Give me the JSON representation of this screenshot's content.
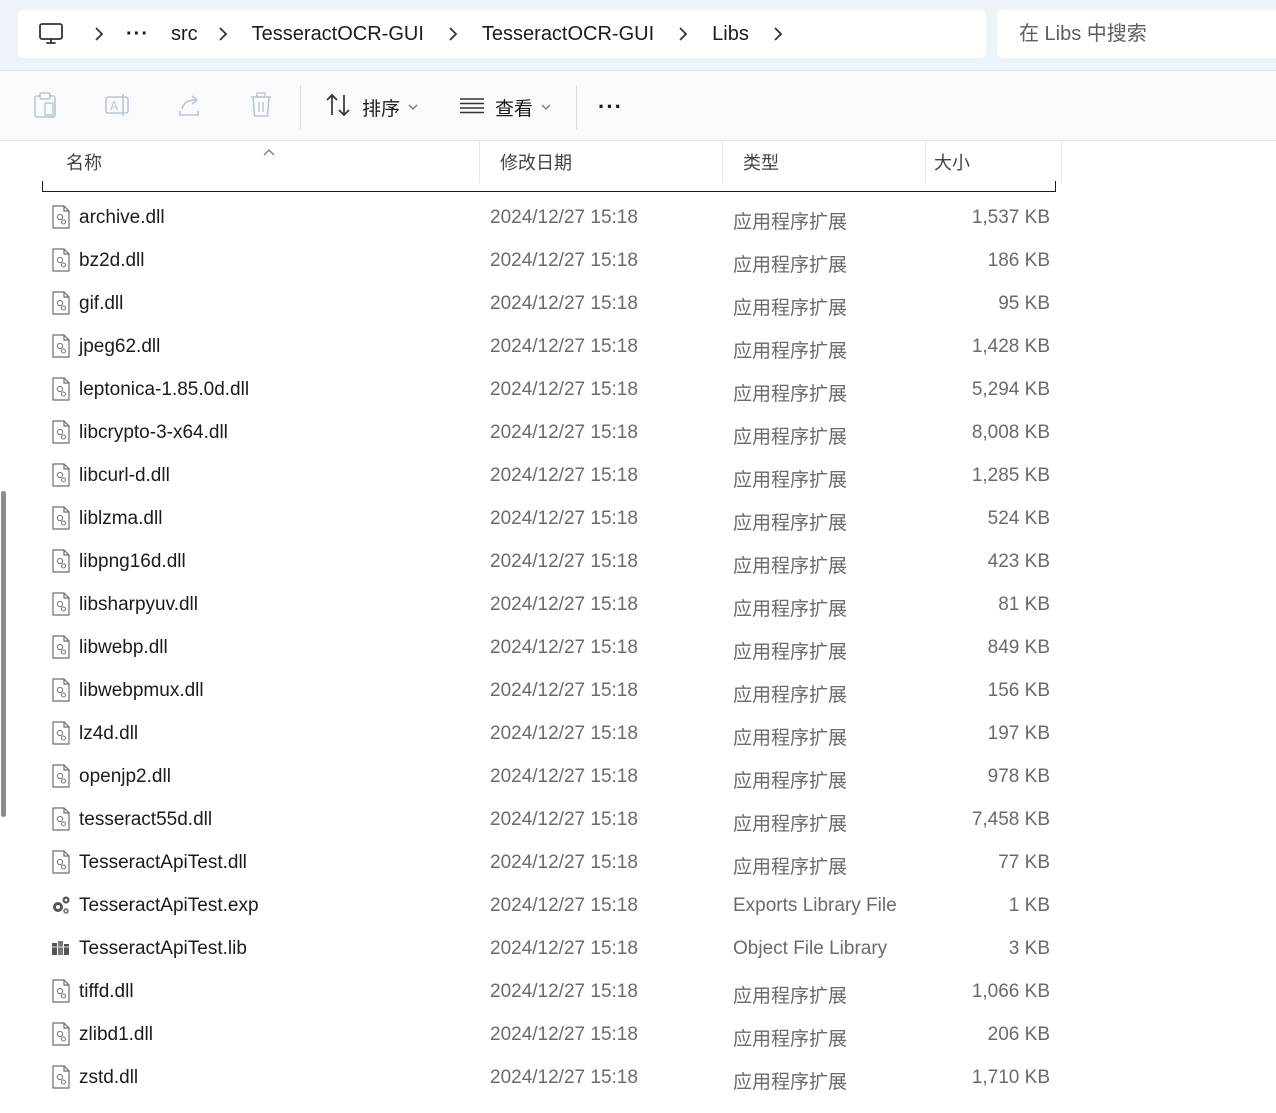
{
  "breadcrumb": {
    "overflow": "···",
    "items": [
      "src",
      "TesseractOCR-GUI",
      "TesseractOCR-GUI",
      "Libs"
    ]
  },
  "search": {
    "placeholder": "在 Libs 中搜索"
  },
  "toolbar": {
    "sort_label": "排序",
    "view_label": "查看",
    "more_label": "···"
  },
  "columns": {
    "name": "名称",
    "date": "修改日期",
    "type": "类型",
    "size": "大小"
  },
  "files": [
    {
      "name": "archive.dll",
      "date": "2024/12/27 15:18",
      "type": "应用程序扩展",
      "size": "1,537 KB",
      "icon": "dll-icon"
    },
    {
      "name": "bz2d.dll",
      "date": "2024/12/27 15:18",
      "type": "应用程序扩展",
      "size": "186 KB",
      "icon": "dll-icon"
    },
    {
      "name": "gif.dll",
      "date": "2024/12/27 15:18",
      "type": "应用程序扩展",
      "size": "95 KB",
      "icon": "dll-icon"
    },
    {
      "name": "jpeg62.dll",
      "date": "2024/12/27 15:18",
      "type": "应用程序扩展",
      "size": "1,428 KB",
      "icon": "dll-icon"
    },
    {
      "name": "leptonica-1.85.0d.dll",
      "date": "2024/12/27 15:18",
      "type": "应用程序扩展",
      "size": "5,294 KB",
      "icon": "dll-icon"
    },
    {
      "name": "libcrypto-3-x64.dll",
      "date": "2024/12/27 15:18",
      "type": "应用程序扩展",
      "size": "8,008 KB",
      "icon": "dll-icon"
    },
    {
      "name": "libcurl-d.dll",
      "date": "2024/12/27 15:18",
      "type": "应用程序扩展",
      "size": "1,285 KB",
      "icon": "dll-icon"
    },
    {
      "name": "liblzma.dll",
      "date": "2024/12/27 15:18",
      "type": "应用程序扩展",
      "size": "524 KB",
      "icon": "dll-icon"
    },
    {
      "name": "libpng16d.dll",
      "date": "2024/12/27 15:18",
      "type": "应用程序扩展",
      "size": "423 KB",
      "icon": "dll-icon"
    },
    {
      "name": "libsharpyuv.dll",
      "date": "2024/12/27 15:18",
      "type": "应用程序扩展",
      "size": "81 KB",
      "icon": "dll-icon"
    },
    {
      "name": "libwebp.dll",
      "date": "2024/12/27 15:18",
      "type": "应用程序扩展",
      "size": "849 KB",
      "icon": "dll-icon"
    },
    {
      "name": "libwebpmux.dll",
      "date": "2024/12/27 15:18",
      "type": "应用程序扩展",
      "size": "156 KB",
      "icon": "dll-icon"
    },
    {
      "name": "lz4d.dll",
      "date": "2024/12/27 15:18",
      "type": "应用程序扩展",
      "size": "197 KB",
      "icon": "dll-icon"
    },
    {
      "name": "openjp2.dll",
      "date": "2024/12/27 15:18",
      "type": "应用程序扩展",
      "size": "978 KB",
      "icon": "dll-icon"
    },
    {
      "name": "tesseract55d.dll",
      "date": "2024/12/27 15:18",
      "type": "应用程序扩展",
      "size": "7,458 KB",
      "icon": "dll-icon"
    },
    {
      "name": "TesseractApiTest.dll",
      "date": "2024/12/27 15:18",
      "type": "应用程序扩展",
      "size": "77 KB",
      "icon": "dll-icon"
    },
    {
      "name": "TesseractApiTest.exp",
      "date": "2024/12/27 15:18",
      "type": "Exports Library File",
      "size": "1 KB",
      "icon": "exp-icon"
    },
    {
      "name": "TesseractApiTest.lib",
      "date": "2024/12/27 15:18",
      "type": "Object File Library",
      "size": "3 KB",
      "icon": "lib-icon"
    },
    {
      "name": "tiffd.dll",
      "date": "2024/12/27 15:18",
      "type": "应用程序扩展",
      "size": "1,066 KB",
      "icon": "dll-icon"
    },
    {
      "name": "zlibd1.dll",
      "date": "2024/12/27 15:18",
      "type": "应用程序扩展",
      "size": "206 KB",
      "icon": "dll-icon"
    },
    {
      "name": "zstd.dll",
      "date": "2024/12/27 15:18",
      "type": "应用程序扩展",
      "size": "1,710 KB",
      "icon": "dll-icon"
    }
  ]
}
